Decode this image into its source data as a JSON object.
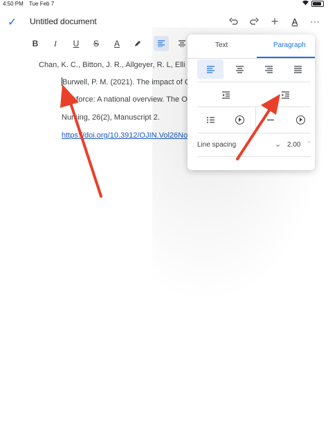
{
  "status_bar": {
    "time": "4:50 PM",
    "date": "Tue Feb 7"
  },
  "header": {
    "title": "Untitled document"
  },
  "document": {
    "lines": [
      "Chan, K. C., Bitton, J. R., Allgeyer, R. L, Elli",
      "Burwell, P. M. (2021). The impact of C",
      "rkforce: A national overview. The O",
      "Nursing, 26(2), Manuscript 2.",
      "https://doi.org/10.3912/OJIN.Vol26No"
    ]
  },
  "format_panel": {
    "tabs": [
      "Text",
      "Paragraph"
    ],
    "active_tab": "Paragraph",
    "line_spacing_label": "Line spacing",
    "line_spacing_value": "2.00"
  },
  "colors": {
    "accent": "#1a73e8",
    "annotation_arrow": "#e8402a"
  }
}
